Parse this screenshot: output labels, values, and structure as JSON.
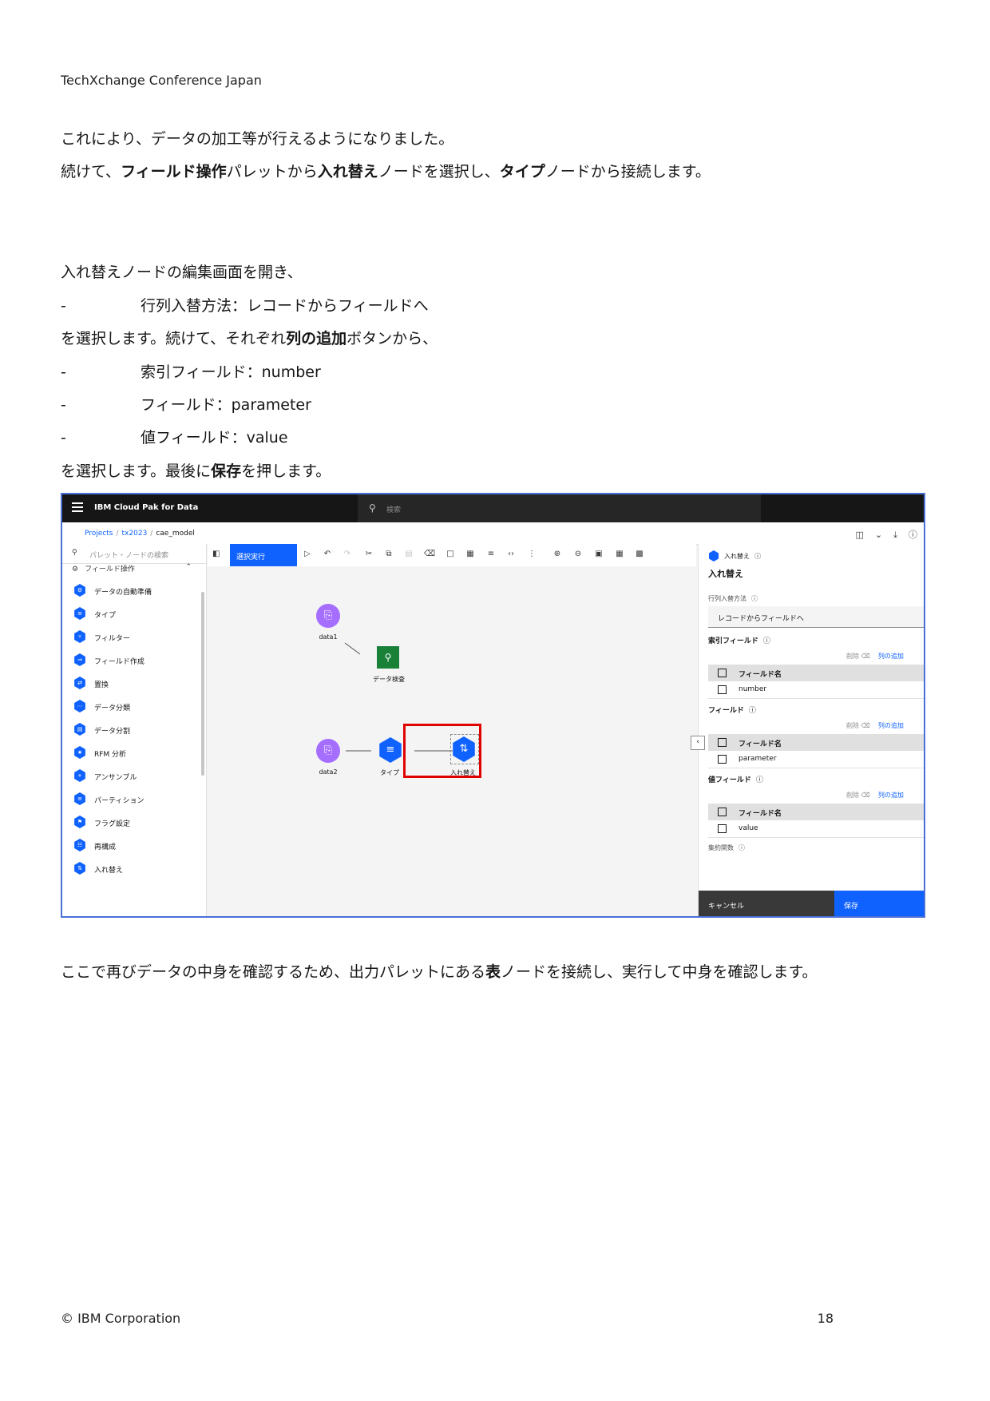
{
  "header": "TechXchange Conference Japan",
  "paragraphs": {
    "p1": "これにより、データの加工等が行えるようになりました。",
    "p2": {
      "a": "続けて、",
      "b_bold": "フィールド操作",
      "c": "パレットから",
      "d_bold": "入れ替え",
      "e": "ノードを選択し、",
      "f_bold": "タイプ",
      "g": "ノードから接続します。"
    },
    "p3": "入れ替えノードの編集画面を開き、",
    "bullet1": {
      "dash": "-",
      "text": "行列入替方法：レコードからフィールドへ"
    },
    "p4": {
      "a": "を選択します。続けて、それぞれ",
      "b_bold": "列の追加",
      "c": "ボタンから、"
    },
    "bullet2": {
      "dash": "-",
      "text": "索引フィールド：number"
    },
    "bullet3": {
      "dash": "-",
      "text": "フィールド：parameter"
    },
    "bullet4": {
      "dash": "-",
      "text": "値フィールド：value"
    },
    "p5": {
      "a": "を選択します。最後に",
      "b_bold": "保存",
      "c": "を押します。"
    },
    "p6": {
      "a": "ここで再びデータの中身を確認するため、出力パレットにある",
      "b_bold": "表",
      "c": "ノードを接続し、実行して中身を確認します。"
    }
  },
  "footer": {
    "copyright": "© IBM Corporation",
    "page": "18"
  },
  "screenshot": {
    "brand": "IBM Cloud Pak for Data",
    "search_placeholder": "検索",
    "breadcrumbs": [
      "Projects",
      "tx2023",
      "cae_model"
    ],
    "palette_search_placeholder": "パレット・ノードの検索",
    "palette_category": "フィールド操作",
    "palette_items": [
      "データの自動準備",
      "タイプ",
      "フィルター",
      "フィールド作成",
      "置換",
      "データ分類",
      "データ分割",
      "RFM 分析",
      "アンサンブル",
      "パーティション",
      "フラグ設定",
      "再構成",
      "入れ替え"
    ],
    "run_button": "選択実行",
    "nodes": {
      "data1": "data1",
      "data_audit": "データ検査",
      "data2": "data2",
      "type": "タイプ",
      "transpose": "入れ替え"
    },
    "properties": {
      "node_type": "入れ替え",
      "title": "入れ替え",
      "method_label": "行列入替方法",
      "method_value": "レコードからフィールドへ",
      "index_field_label": "索引フィールド",
      "fields_label": "フィールド",
      "value_field_label": "値フィールド",
      "delete": "削除",
      "add_column": "列の追加",
      "column_header": "フィールド名",
      "index_value": "number",
      "field_value": "parameter",
      "value_value": "value",
      "aggregate_label": "集約関数",
      "cancel": "キャンセル",
      "save": "保存"
    }
  }
}
